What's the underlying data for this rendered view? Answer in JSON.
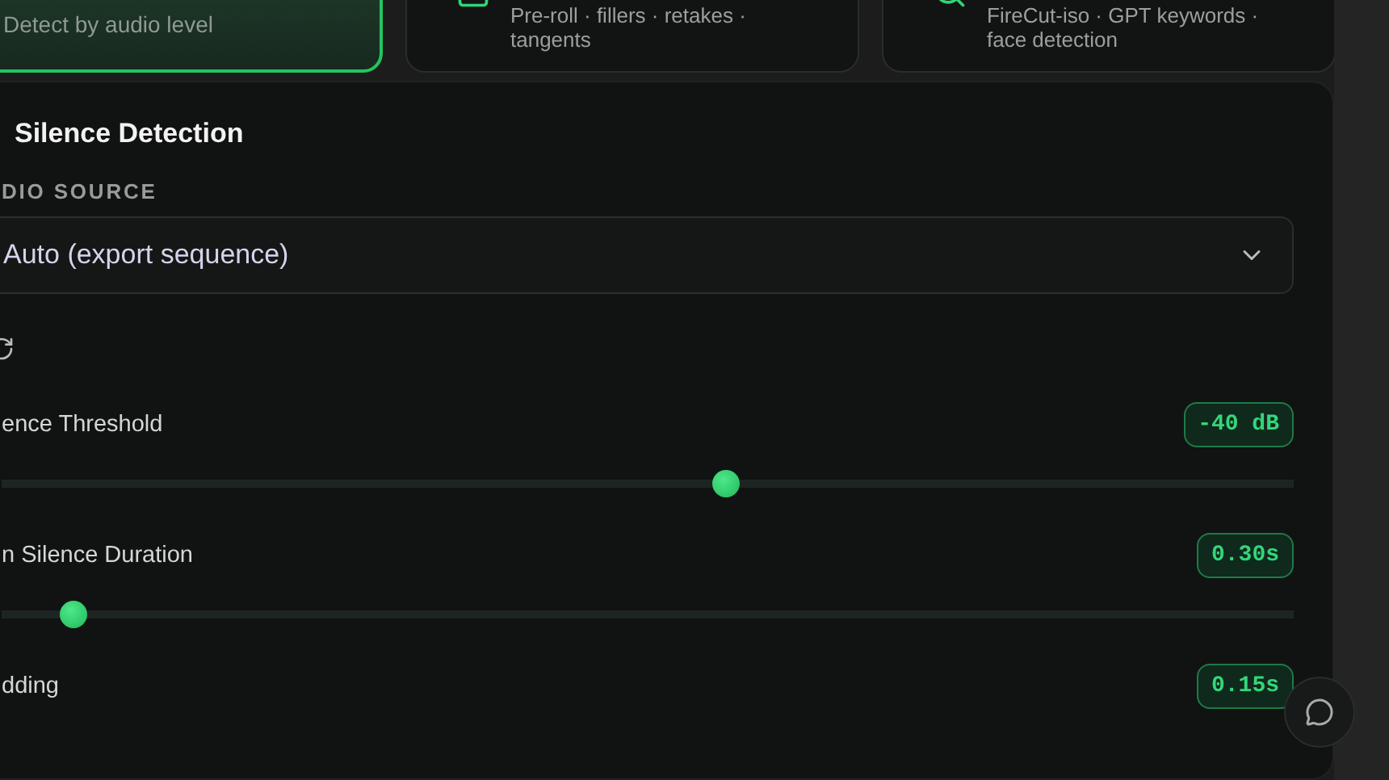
{
  "modes": [
    {
      "kind": "level",
      "subtitle": "Detect by audio level",
      "selected": true
    },
    {
      "kind": "check",
      "lines": [
        "Pre-roll · fillers · retakes ·",
        "tangents"
      ],
      "selected": false
    },
    {
      "kind": "search",
      "lines": [
        "FireCut-iso · GPT keywords ·",
        "face detection"
      ],
      "selected": false
    }
  ],
  "panel": {
    "title": "Silence Detection",
    "source_label": "DIO SOURCE",
    "source_value": "Auto (export sequence)",
    "settings": [
      {
        "label": "ence Threshold",
        "reading": "-40 dB",
        "level": 0.56
      },
      {
        "label": "n Silence Duration",
        "reading": "0.30s",
        "level": 0.055
      },
      {
        "label": "dding",
        "reading": "0.15s"
      }
    ]
  }
}
